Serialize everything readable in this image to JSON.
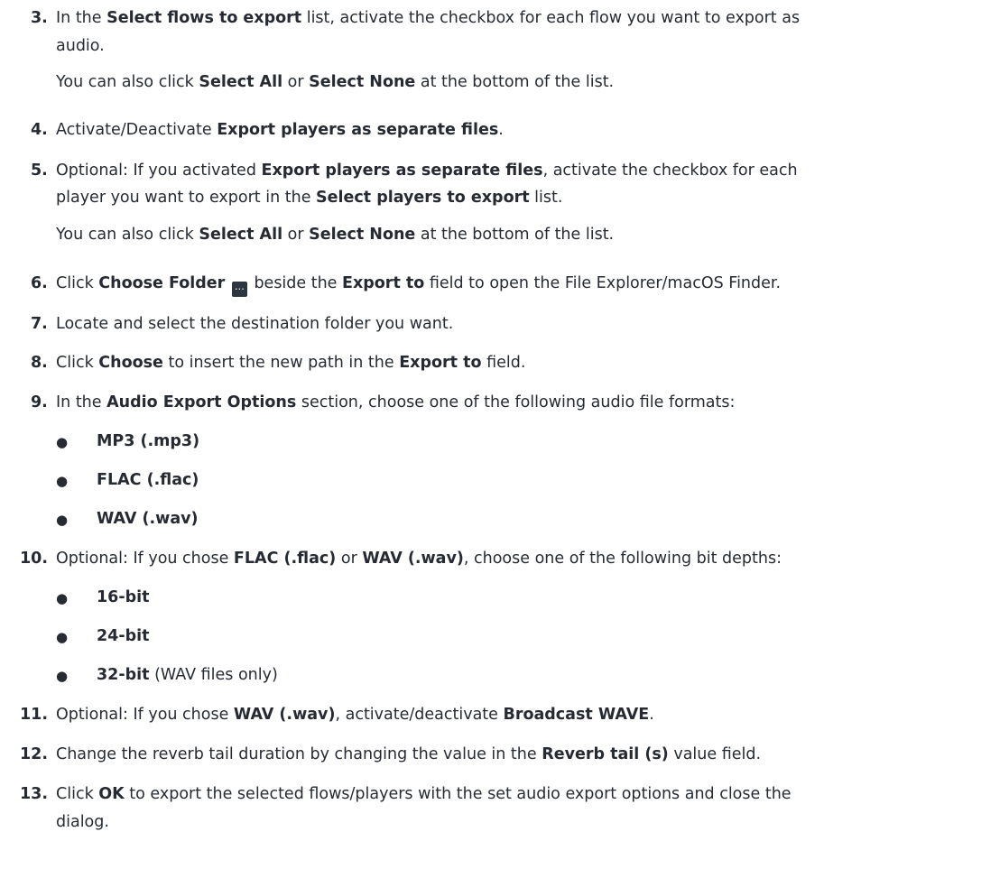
{
  "steps": [
    {
      "num": "3.",
      "line1": [
        "In the ",
        "Select flows to export",
        " list, activate the checkbox for each flow you want to export as"
      ],
      "line2": "audio.",
      "note": [
        "You can also click ",
        "Select All",
        " or ",
        "Select None",
        " at the bottom of the list."
      ]
    },
    {
      "num": "4.",
      "line1": [
        "Activate/Deactivate ",
        "Export players as separate files",
        "."
      ]
    },
    {
      "num": "5.",
      "line1": [
        "Optional: If you activated ",
        "Export players as separate files",
        ", activate the checkbox for each"
      ],
      "line2": [
        "player you want to export in the ",
        "Select players to export",
        " list."
      ],
      "note": [
        "You can also click ",
        "Select All",
        " or ",
        "Select None",
        " at the bottom of the list."
      ]
    },
    {
      "num": "6.",
      "line1": [
        "Click ",
        "Choose Folder",
        " beside the ",
        "Export to",
        " field to open the File Explorer/macOS Finder."
      ],
      "icon": "ellipsis-icon",
      "icon_glyph": "…"
    },
    {
      "num": "7.",
      "line1": [
        "Locate and select the destination folder you want."
      ]
    },
    {
      "num": "8.",
      "line1": [
        "Click ",
        "Choose",
        " to insert the new path in the ",
        "Export to",
        " field."
      ]
    },
    {
      "num": "9.",
      "line1": [
        "In the ",
        "Audio Export Options",
        " section, choose one of the following audio file formats:"
      ],
      "bullets": [
        "MP3 (.mp3)",
        "FLAC (.flac)",
        "WAV (.wav)"
      ]
    },
    {
      "num": "10.",
      "line1": [
        "Optional: If you chose ",
        "FLAC (.flac)",
        " or ",
        "WAV (.wav)",
        ", choose one of the following bit depths:"
      ],
      "bullets": [
        "16-bit",
        "24-bit",
        "32-bit"
      ],
      "bullet3_suffix": " (WAV files only)"
    },
    {
      "num": "11.",
      "line1": [
        "Optional: If you chose ",
        "WAV (.wav)",
        ", activate/deactivate ",
        "Broadcast WAVE",
        "."
      ]
    },
    {
      "num": "12.",
      "line1": [
        "Change the reverb tail duration by changing the value in the ",
        "Reverb tail (s)",
        " value field."
      ]
    },
    {
      "num": "13.",
      "line1": [
        "Click ",
        "OK",
        " to export the selected flows/players with the set audio export options and close the"
      ],
      "line2": "dialog."
    }
  ]
}
